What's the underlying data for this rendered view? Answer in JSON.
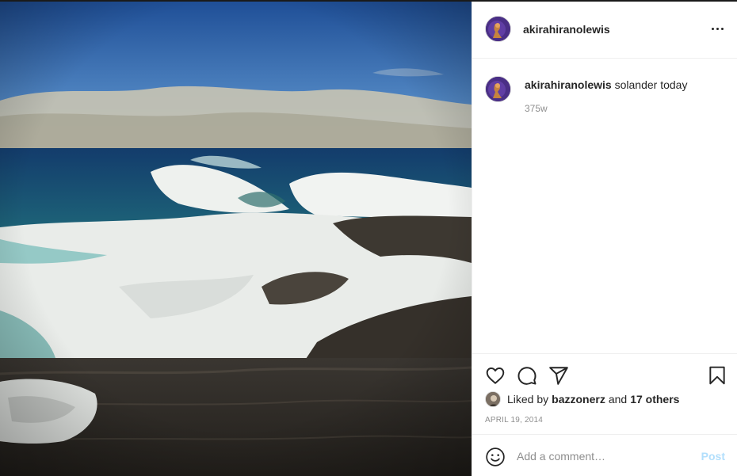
{
  "post": {
    "username": "akirahiranolewis",
    "caption": "solander today",
    "caption_age": "375w",
    "liked_by_prefix": "Liked by",
    "liked_by_user": "bazzonerz",
    "liked_by_and": "and",
    "liked_by_others": "17 others",
    "date": "APRIL 19, 2014"
  },
  "icons": {
    "options": "more-options-icon",
    "like": "heart-icon",
    "comment": "comment-icon",
    "share": "paper-plane-icon",
    "save": "bookmark-icon",
    "emoji": "smiley-icon"
  },
  "comment_box": {
    "placeholder": "Add a comment…",
    "post_label": "Post"
  },
  "colors": {
    "post_disabled": "#b2dffc",
    "muted_text": "#8e8e8e",
    "border": "#efefef"
  }
}
